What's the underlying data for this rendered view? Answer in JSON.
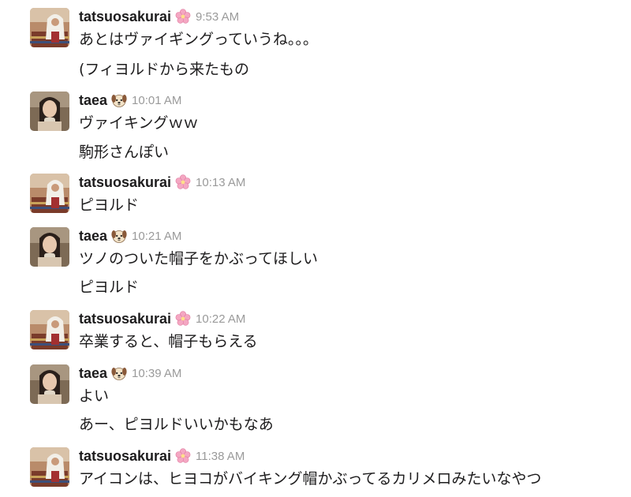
{
  "users": {
    "tatsuo": {
      "name": "tatsuosakurai",
      "status_icon": "cherry-blossom-icon"
    },
    "taea": {
      "name": "taea",
      "status_icon": "dog-face-icon"
    }
  },
  "messages": [
    {
      "user": "tatsuosakurai",
      "time": "9:53 AM",
      "lines": [
        "あとはヴァイギングっていうね。。。",
        "(フィヨルドから来たもの"
      ]
    },
    {
      "user": "taea",
      "time": "10:01 AM",
      "lines": [
        "ヴァイキングｗｗ",
        "駒形さんぽい"
      ]
    },
    {
      "user": "tatsuosakurai",
      "time": "10:13 AM",
      "lines": [
        "ピヨルド"
      ]
    },
    {
      "user": "taea",
      "time": "10:21 AM",
      "lines": [
        "ツノのついた帽子をかぶってほしい",
        "ピヨルド"
      ]
    },
    {
      "user": "tatsuosakurai",
      "time": "10:22 AM",
      "lines": [
        "卒業すると、帽子もらえる"
      ]
    },
    {
      "user": "taea",
      "time": "10:39 AM",
      "lines": [
        "よい",
        "あー、ピヨルドいいかもなあ"
      ]
    },
    {
      "user": "tatsuosakurai",
      "time": "11:38 AM",
      "lines": [
        "アイコンは、ヒヨコがバイキング帽かぶってるカリメロみたいなやつ"
      ]
    }
  ],
  "colors": {
    "username": "#1d1c1d",
    "timestamp": "#9a9a9a",
    "text": "#1d1c1d",
    "background": "#ffffff"
  }
}
